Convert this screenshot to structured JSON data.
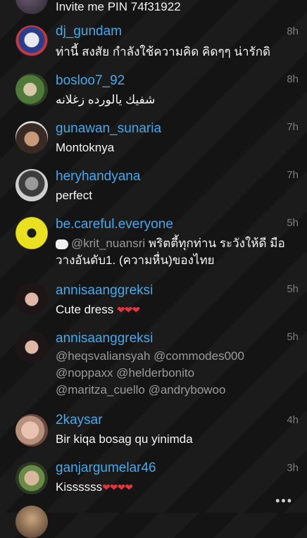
{
  "top_partial": {
    "text": "Invite me PIN 74f31922"
  },
  "comments": [
    {
      "username": "dj_gundam",
      "time": "8h",
      "text": "ท่านี้ สงสัย กำลังใช้ความคิด คิดๆๆ น่ารักดิ"
    },
    {
      "username": "bosloo7_92",
      "time": "8h",
      "text": "شفيك يالورده زغلانه"
    },
    {
      "username": "gunawan_sunaria",
      "time": "7h",
      "text": "Montoknya"
    },
    {
      "username": "heryhandyana",
      "time": "7h",
      "text": "perfect"
    },
    {
      "username": "be.careful.everyone",
      "time": "5h",
      "mention": "@krit_nuansri",
      "text_line1": " พริตตี้ทุกท่าน ระวังให้ดี มือ",
      "text_line2": "วางอันดับ1. (ความหื่น)ของไทย"
    },
    {
      "username": "annisaanggreksi",
      "time": "5h",
      "text": "Cute dress",
      "hearts": "❤❤❤"
    },
    {
      "username": "annisaanggreksi",
      "time": "5h",
      "mentions_line1": "@heqsvaliansyah @commodes000",
      "mentions_line2": "@noppaxx @helderbonito",
      "mentions_line3": "@maritza_cuello @andrybowoo"
    },
    {
      "username": "2kaysar",
      "time": "4h",
      "text": "Bir kiqa bosag qu yinimda"
    },
    {
      "username": "ganjargumelar46",
      "time": "3h",
      "text": "Kissssss",
      "hearts": "❤❤❤❤"
    }
  ],
  "more_label": "•••",
  "colors": {
    "username": "#4aa7e8",
    "time": "#7d7d7d",
    "mention": "#9a9a9a",
    "heart": "#e0353f"
  }
}
